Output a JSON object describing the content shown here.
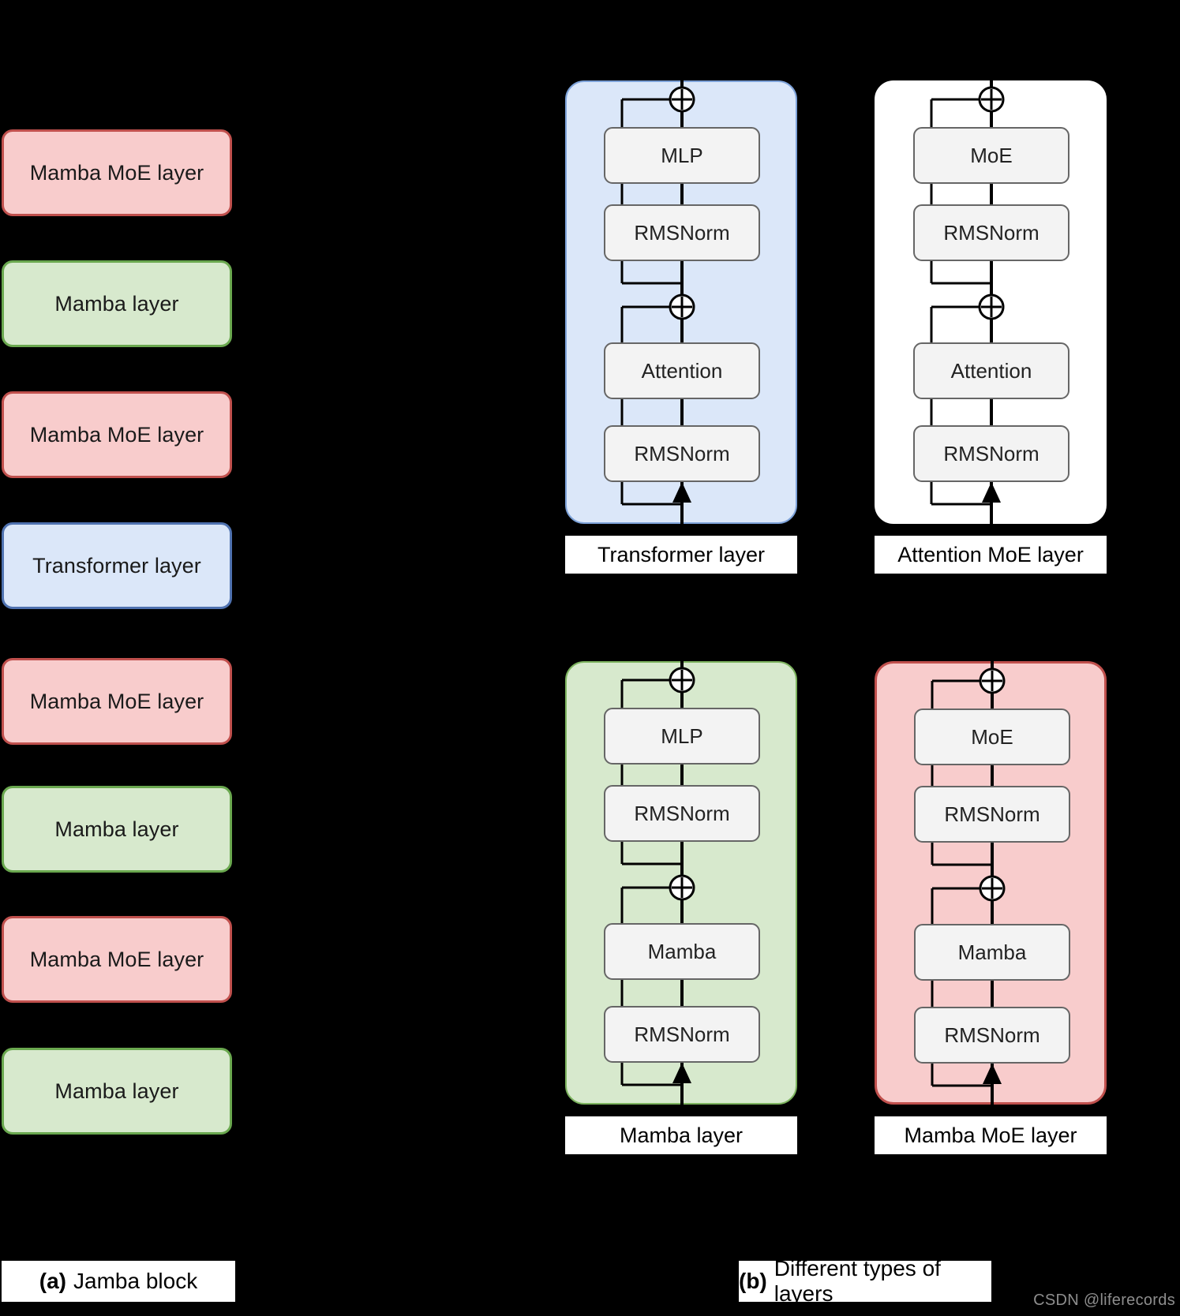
{
  "figure": {
    "caption_a_tag": "(a)",
    "caption_a_text": "Jamba block",
    "caption_b_tag": "(b)",
    "caption_b_text": "Different types of layers",
    "watermark": "CSDN @liferecords"
  },
  "colors": {
    "pink_fill": "#f8cccc",
    "pink_border": "#c0504d",
    "green_fill": "#d7e9cd",
    "green_border": "#6aa84f",
    "blue_fill": "#dbe7f9",
    "blue_border": "#4f72b0",
    "white_fill": "#ffffff",
    "inner_fill": "#f3f3f3",
    "inner_border": "#666666",
    "background": "#000000",
    "watermark_text": "#8d8d8d"
  },
  "jamba_block": {
    "layers": [
      {
        "label": "Mamba MoE layer",
        "kind": "pink"
      },
      {
        "label": "Mamba layer",
        "kind": "green"
      },
      {
        "label": "Mamba MoE layer",
        "kind": "pink"
      },
      {
        "label": "Transformer layer",
        "kind": "blue"
      },
      {
        "label": "Mamba MoE layer",
        "kind": "pink"
      },
      {
        "label": "Mamba layer",
        "kind": "green"
      },
      {
        "label": "Mamba MoE layer",
        "kind": "pink"
      },
      {
        "label": "Mamba layer",
        "kind": "green"
      }
    ]
  },
  "layer_types": [
    {
      "name": "Transformer layer",
      "kind": "blue",
      "top_block": "MLP",
      "top_norm": "RMSNorm",
      "bottom_block": "Attention",
      "bottom_norm": "RMSNorm",
      "adder_top": "plus-circle",
      "adder_bottom": "plus-circle"
    },
    {
      "name": "Attention MoE layer",
      "kind": "white",
      "top_block": "MoE",
      "top_norm": "RMSNorm",
      "bottom_block": "Attention",
      "bottom_norm": "RMSNorm",
      "adder_top": "plus-circle",
      "adder_bottom": "plus-circle"
    },
    {
      "name": "Mamba layer",
      "kind": "green",
      "top_block": "MLP",
      "top_norm": "RMSNorm",
      "bottom_block": "Mamba",
      "bottom_norm": "RMSNorm",
      "adder_top": "plus-circle",
      "adder_bottom": "plus-circle"
    },
    {
      "name": "Mamba MoE layer",
      "kind": "pink",
      "top_block": "MoE",
      "top_norm": "RMSNorm",
      "bottom_block": "Mamba",
      "bottom_norm": "RMSNorm",
      "adder_top": "plus-circle",
      "adder_bottom": "plus-circle"
    }
  ]
}
